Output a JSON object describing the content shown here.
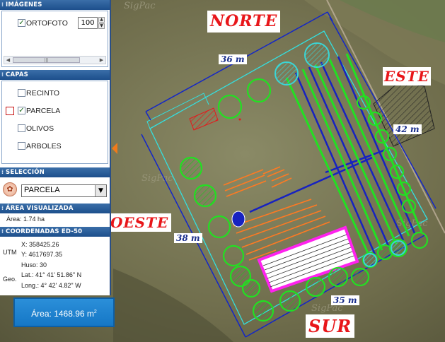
{
  "panel": {
    "imagenes": {
      "header": "IMÁGENES",
      "layer_label": "ORTOFOTO",
      "opacity_value": "100"
    },
    "capas": {
      "header": "CAPAS",
      "items": [
        {
          "label": "RECINTO",
          "checked": false
        },
        {
          "label": "PARCELA",
          "checked": true
        },
        {
          "label": "OLIVOS",
          "checked": false
        },
        {
          "label": "ARBOLES",
          "checked": false
        }
      ]
    },
    "seleccion": {
      "header": "SELECCIÓN",
      "selected": "PARCELA"
    },
    "area_visualizada": {
      "header": "ÁREA VISUALIZADA",
      "text": "Área: 1.74 ha"
    },
    "coordenadas": {
      "header": "COORDENADAS ED-50",
      "utm_label": "UTM",
      "x": "X:  358425.26",
      "y": "Y:  4617697.35",
      "geo_label": "Geo.",
      "huso": "Huso: 30",
      "lat": "Lat.: 41° 41' 51.86\" N",
      "long": "Long.: 4° 42' 4.82\" W"
    }
  },
  "area_result": {
    "label": "Área: 1468.96 m",
    "sup": "2"
  },
  "map": {
    "watermark": "SigPac",
    "labels": {
      "norte": "NORTE",
      "sur": "SUR",
      "este": "ESTE",
      "oeste": "OESTE"
    },
    "measures": {
      "top": "36 m",
      "right": "42 m",
      "left": "38 m",
      "bottom": "35 m"
    },
    "colors": {
      "boundary": "#33e0e0",
      "dimension": "#1326c8",
      "trees": "#22e022",
      "rows": "#1722c0",
      "pink": "#ff22ee",
      "orange": "#ff7a22",
      "red": "#e8161a"
    }
  }
}
